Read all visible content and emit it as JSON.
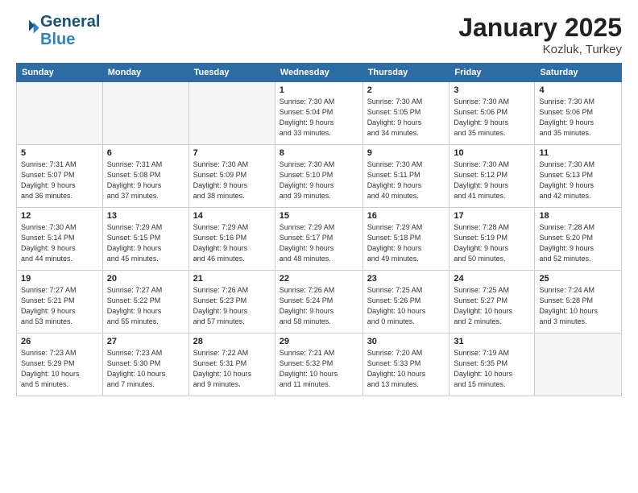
{
  "header": {
    "logo_line1": "General",
    "logo_line2": "Blue",
    "month_title": "January 2025",
    "location": "Kozluk, Turkey"
  },
  "days_of_week": [
    "Sunday",
    "Monday",
    "Tuesday",
    "Wednesday",
    "Thursday",
    "Friday",
    "Saturday"
  ],
  "weeks": [
    [
      {
        "num": "",
        "info": ""
      },
      {
        "num": "",
        "info": ""
      },
      {
        "num": "",
        "info": ""
      },
      {
        "num": "1",
        "info": "Sunrise: 7:30 AM\nSunset: 5:04 PM\nDaylight: 9 hours\nand 33 minutes."
      },
      {
        "num": "2",
        "info": "Sunrise: 7:30 AM\nSunset: 5:05 PM\nDaylight: 9 hours\nand 34 minutes."
      },
      {
        "num": "3",
        "info": "Sunrise: 7:30 AM\nSunset: 5:06 PM\nDaylight: 9 hours\nand 35 minutes."
      },
      {
        "num": "4",
        "info": "Sunrise: 7:30 AM\nSunset: 5:06 PM\nDaylight: 9 hours\nand 35 minutes."
      }
    ],
    [
      {
        "num": "5",
        "info": "Sunrise: 7:31 AM\nSunset: 5:07 PM\nDaylight: 9 hours\nand 36 minutes."
      },
      {
        "num": "6",
        "info": "Sunrise: 7:31 AM\nSunset: 5:08 PM\nDaylight: 9 hours\nand 37 minutes."
      },
      {
        "num": "7",
        "info": "Sunrise: 7:30 AM\nSunset: 5:09 PM\nDaylight: 9 hours\nand 38 minutes."
      },
      {
        "num": "8",
        "info": "Sunrise: 7:30 AM\nSunset: 5:10 PM\nDaylight: 9 hours\nand 39 minutes."
      },
      {
        "num": "9",
        "info": "Sunrise: 7:30 AM\nSunset: 5:11 PM\nDaylight: 9 hours\nand 40 minutes."
      },
      {
        "num": "10",
        "info": "Sunrise: 7:30 AM\nSunset: 5:12 PM\nDaylight: 9 hours\nand 41 minutes."
      },
      {
        "num": "11",
        "info": "Sunrise: 7:30 AM\nSunset: 5:13 PM\nDaylight: 9 hours\nand 42 minutes."
      }
    ],
    [
      {
        "num": "12",
        "info": "Sunrise: 7:30 AM\nSunset: 5:14 PM\nDaylight: 9 hours\nand 44 minutes."
      },
      {
        "num": "13",
        "info": "Sunrise: 7:29 AM\nSunset: 5:15 PM\nDaylight: 9 hours\nand 45 minutes."
      },
      {
        "num": "14",
        "info": "Sunrise: 7:29 AM\nSunset: 5:16 PM\nDaylight: 9 hours\nand 46 minutes."
      },
      {
        "num": "15",
        "info": "Sunrise: 7:29 AM\nSunset: 5:17 PM\nDaylight: 9 hours\nand 48 minutes."
      },
      {
        "num": "16",
        "info": "Sunrise: 7:29 AM\nSunset: 5:18 PM\nDaylight: 9 hours\nand 49 minutes."
      },
      {
        "num": "17",
        "info": "Sunrise: 7:28 AM\nSunset: 5:19 PM\nDaylight: 9 hours\nand 50 minutes."
      },
      {
        "num": "18",
        "info": "Sunrise: 7:28 AM\nSunset: 5:20 PM\nDaylight: 9 hours\nand 52 minutes."
      }
    ],
    [
      {
        "num": "19",
        "info": "Sunrise: 7:27 AM\nSunset: 5:21 PM\nDaylight: 9 hours\nand 53 minutes."
      },
      {
        "num": "20",
        "info": "Sunrise: 7:27 AM\nSunset: 5:22 PM\nDaylight: 9 hours\nand 55 minutes."
      },
      {
        "num": "21",
        "info": "Sunrise: 7:26 AM\nSunset: 5:23 PM\nDaylight: 9 hours\nand 57 minutes."
      },
      {
        "num": "22",
        "info": "Sunrise: 7:26 AM\nSunset: 5:24 PM\nDaylight: 9 hours\nand 58 minutes."
      },
      {
        "num": "23",
        "info": "Sunrise: 7:25 AM\nSunset: 5:26 PM\nDaylight: 10 hours\nand 0 minutes."
      },
      {
        "num": "24",
        "info": "Sunrise: 7:25 AM\nSunset: 5:27 PM\nDaylight: 10 hours\nand 2 minutes."
      },
      {
        "num": "25",
        "info": "Sunrise: 7:24 AM\nSunset: 5:28 PM\nDaylight: 10 hours\nand 3 minutes."
      }
    ],
    [
      {
        "num": "26",
        "info": "Sunrise: 7:23 AM\nSunset: 5:29 PM\nDaylight: 10 hours\nand 5 minutes."
      },
      {
        "num": "27",
        "info": "Sunrise: 7:23 AM\nSunset: 5:30 PM\nDaylight: 10 hours\nand 7 minutes."
      },
      {
        "num": "28",
        "info": "Sunrise: 7:22 AM\nSunset: 5:31 PM\nDaylight: 10 hours\nand 9 minutes."
      },
      {
        "num": "29",
        "info": "Sunrise: 7:21 AM\nSunset: 5:32 PM\nDaylight: 10 hours\nand 11 minutes."
      },
      {
        "num": "30",
        "info": "Sunrise: 7:20 AM\nSunset: 5:33 PM\nDaylight: 10 hours\nand 13 minutes."
      },
      {
        "num": "31",
        "info": "Sunrise: 7:19 AM\nSunset: 5:35 PM\nDaylight: 10 hours\nand 15 minutes."
      },
      {
        "num": "",
        "info": ""
      }
    ]
  ]
}
